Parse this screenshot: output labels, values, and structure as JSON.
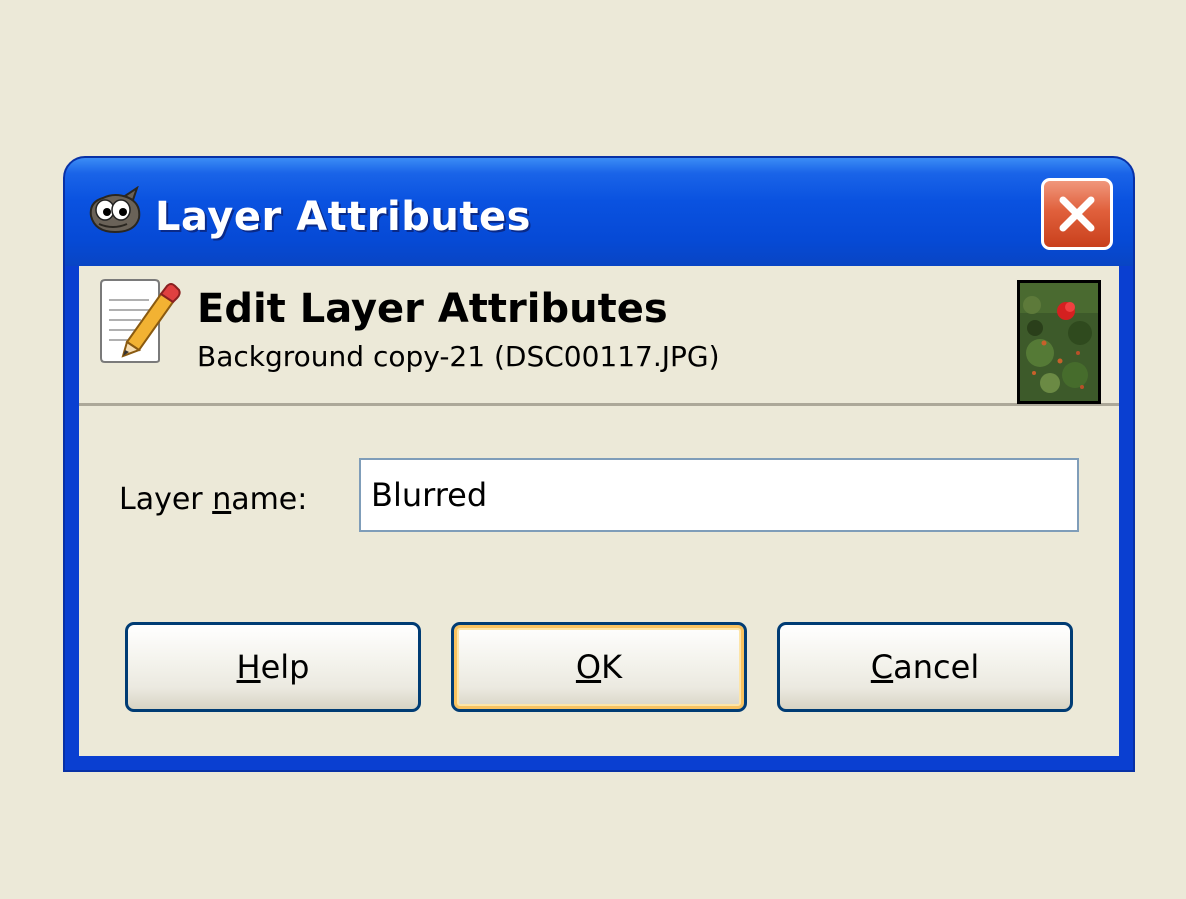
{
  "window": {
    "title": "Layer Attributes",
    "app_icon": "gimp-wilber-icon",
    "close_icon": "close-icon"
  },
  "header": {
    "title": "Edit Layer Attributes",
    "subtitle": "Background copy-21 (DSC00117.JPG)",
    "icon": "edit-document-icon",
    "thumbnail": "layer-thumbnail"
  },
  "form": {
    "layer_name_label_pre": "Layer ",
    "layer_name_label_mnemonic": "n",
    "layer_name_label_post": "ame:",
    "layer_name_value": "Blurred"
  },
  "buttons": {
    "help": {
      "mnemonic": "H",
      "rest": "elp"
    },
    "ok": {
      "mnemonic": "O",
      "rest": "K"
    },
    "cancel": {
      "mnemonic": "C",
      "rest": "ancel"
    }
  },
  "colors": {
    "titlebar": "#0a52e0",
    "window_face": "#ece9d8",
    "close_button": "#e0603c",
    "default_button_glow": "#f8c260",
    "input_border": "#7f9db9"
  }
}
